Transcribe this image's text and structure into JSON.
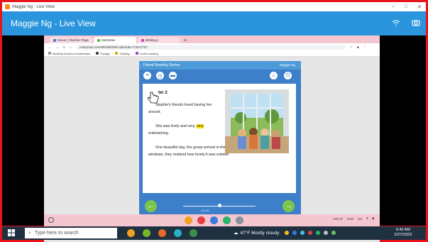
{
  "window": {
    "title": "Maggie Ng - Live View",
    "controls": [
      "–",
      "□",
      "✕"
    ]
  },
  "app_header": {
    "title": "Maggie Ng - Live View",
    "icons": [
      "wifi-icon",
      "camera-icon"
    ]
  },
  "browser": {
    "tabs": [
      {
        "label": "Clever | Teacher Page",
        "color": "#4a7bd5",
        "active": false
      },
      {
        "label": "MobyMax",
        "color": "#62b84a",
        "active": true
      },
      {
        "label": "Writing p",
        "color": "#c04ab0",
        "active": false
      }
    ],
    "url": "mobymax.com/MN/MR/MR.aib/Index?72547787",
    "bookmarks": [
      {
        "label": "students.avusd.us bookmarks",
        "color": "#999999"
      },
      {
        "label": "Prodigy",
        "color": "#444444"
      },
      {
        "label": "Gaming",
        "color": "#d0b000"
      },
      {
        "label": "Level Learning",
        "color": "#8c4ac0"
      }
    ]
  },
  "reader": {
    "header_title": "Paired Reading Stories",
    "user_name": "Maggie Ng",
    "chapter_title": "ter 2",
    "paragraphs": [
      {
        "text": "Stephie's friends loved having her around."
      },
      {
        "before": "She was lively and very, ",
        "highlight": "very",
        "after": " entertaining."
      },
      {
        "text": "One beautiful day, the group arrived in the cafeteria. As they walked by the windows, they realized how lovely it was outside."
      }
    ],
    "progress": {
      "current": 8,
      "total": 15,
      "label": "8 of 15"
    }
  },
  "shelf": {
    "date": "Feb 27",
    "time": "9:40",
    "region": "US"
  },
  "taskbar": {
    "search_placeholder": "Type here to search",
    "weather": "47°F  Mostly cloudy",
    "time": "9:40 AM",
    "date": "2/27/2023"
  }
}
